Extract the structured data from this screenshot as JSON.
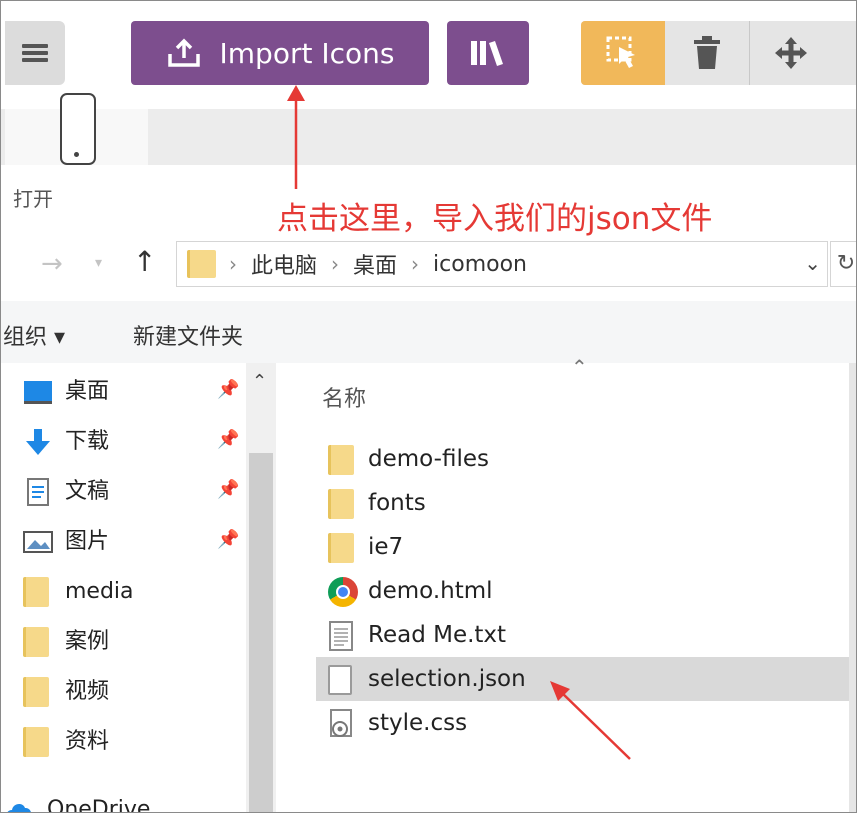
{
  "toolbar": {
    "import_label": "Import Icons",
    "menu_icon": "hamburger-icon",
    "import_icon": "import-tray-icon",
    "library_icon": "library-icon",
    "select_icon": "select-cursor-icon",
    "delete_icon": "trash-icon",
    "move_icon": "move-arrows-icon",
    "accent_purple": "#7d4e8e",
    "accent_orange": "#f1b85a"
  },
  "dialog": {
    "title": "打开",
    "annotation": "点击这里，导入我们的json文件",
    "annotation_color": "#e53935"
  },
  "address": {
    "crumbs": [
      "此电脑",
      "桌面",
      "icomoon"
    ]
  },
  "commands": {
    "organize": "组织 ▾",
    "new_folder": "新建文件夹"
  },
  "nav": {
    "items": [
      {
        "label": "桌面",
        "icon": "desktop-icon"
      },
      {
        "label": "下载",
        "icon": "download-icon"
      },
      {
        "label": "文稿",
        "icon": "document-icon"
      },
      {
        "label": "图片",
        "icon": "pictures-icon"
      },
      {
        "label": "media",
        "icon": "folder-icon"
      },
      {
        "label": "案例",
        "icon": "folder-icon"
      },
      {
        "label": "视频",
        "icon": "folder-icon"
      },
      {
        "label": "资料",
        "icon": "folder-icon"
      },
      {
        "label": "OneDrive",
        "icon": "cloud-icon"
      }
    ]
  },
  "files": {
    "column_name": "名称",
    "items": [
      {
        "name": "demo-files",
        "type": "folder"
      },
      {
        "name": "fonts",
        "type": "folder"
      },
      {
        "name": "ie7",
        "type": "folder"
      },
      {
        "name": "demo.html",
        "type": "chrome"
      },
      {
        "name": "Read Me.txt",
        "type": "text"
      },
      {
        "name": "selection.json",
        "type": "file",
        "selected": true
      },
      {
        "name": "style.css",
        "type": "css"
      }
    ]
  }
}
